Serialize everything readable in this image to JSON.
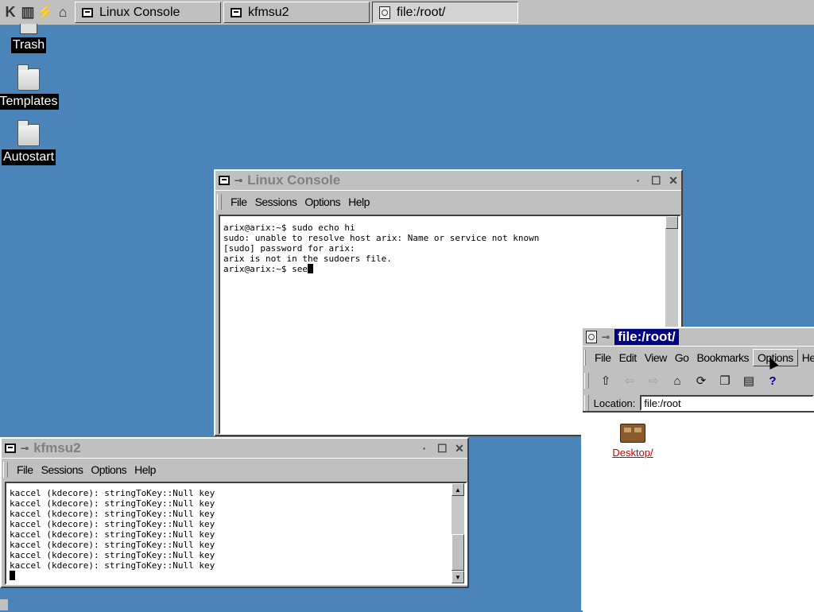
{
  "taskbar": {
    "launcher_label": "K",
    "tasks": [
      {
        "label": "Linux Console",
        "active": false
      },
      {
        "label": "kfmsu2",
        "active": false
      },
      {
        "label": "file:/root/",
        "active": true
      }
    ]
  },
  "desktop": {
    "icons": [
      {
        "label": "Trash"
      },
      {
        "label": "Templates"
      },
      {
        "label": "Autostart"
      }
    ]
  },
  "linux_console": {
    "title": "Linux Console",
    "menu": [
      "File",
      "Sessions",
      "Options",
      "Help"
    ],
    "lines": [
      "arix@arix:~$ sudo echo hi",
      "sudo: unable to resolve host arix: Name or service not known",
      "[sudo] password for arix:",
      "arix is not in the sudoers file.",
      "arix@arix:~$ see"
    ]
  },
  "kfmsu2": {
    "title": "kfmsu2",
    "menu": [
      "File",
      "Sessions",
      "Options",
      "Help"
    ],
    "lines": [
      "kaccel (kdecore): stringToKey::Null key",
      "kaccel (kdecore): stringToKey::Null key",
      "kaccel (kdecore): stringToKey::Null key",
      "kaccel (kdecore): stringToKey::Null key",
      "kaccel (kdecore): stringToKey::Null key",
      "kaccel (kdecore): stringToKey::Null key",
      "kaccel (kdecore): stringToKey::Null key",
      "kaccel (kdecore): stringToKey::Null key"
    ]
  },
  "file_manager": {
    "title": "file:/root/",
    "menu": [
      "File",
      "Edit",
      "View",
      "Go",
      "Bookmarks",
      "Options",
      "Help"
    ],
    "location_label": "Location:",
    "location_value": "file:/root",
    "items": [
      {
        "label": "Desktop/"
      }
    ]
  },
  "colors": {
    "desktop_bg": "#4a84b8",
    "active_title": "#000080",
    "link_red": "#cc0000"
  }
}
